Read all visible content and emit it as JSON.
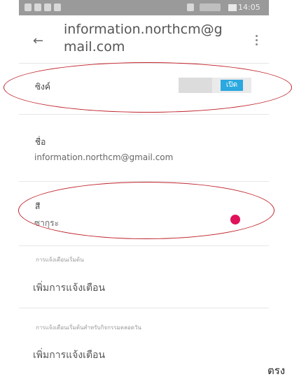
{
  "status_bar": {
    "time": "14:05"
  },
  "header": {
    "account": "information.northcm@gmail.com"
  },
  "sync": {
    "label": "ซิงค์",
    "toggle_label": "เปิด"
  },
  "name": {
    "label": "ชื่อ",
    "value": "information.northcm@gmail.com"
  },
  "color": {
    "label": "สี",
    "value": "ซากุระ",
    "swatch": "#e0125a"
  },
  "notifications": {
    "header": "การแจ้งเตือนเริ่มต้น",
    "add_label": "เพิ่มการแจ้งเตือน"
  },
  "allday_notifications": {
    "header": "การแจ้งเตือนเริ่มต้นสำหรับกิจกรรมตลอดวัน",
    "add_label": "เพิ่มการแจ้งเตือน"
  },
  "annotations": {
    "accent": "#c0222a"
  },
  "caption": {
    "text": "ตรง"
  }
}
